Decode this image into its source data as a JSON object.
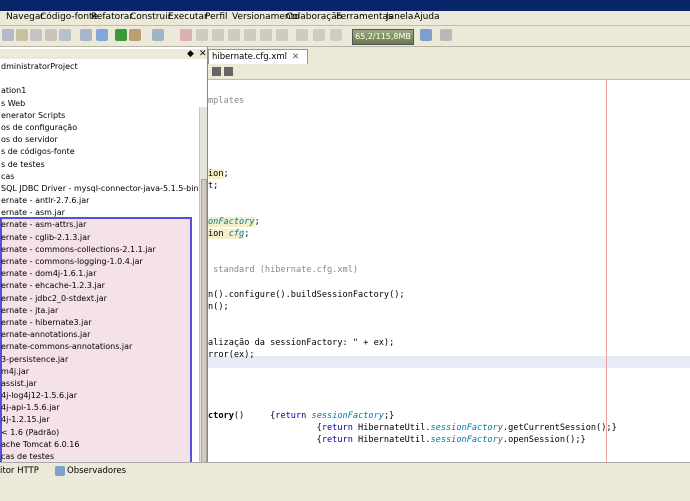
{
  "menu": [
    "Navegar",
    "Código-fonte",
    "Refatorar",
    "Construir",
    "Executar",
    "Perfil",
    "Versionamento",
    "Colaboração",
    "Ferramentas",
    "Janela",
    "Ajuda"
  ],
  "memory": "65,2/115,8MB",
  "project_panel": {
    "controls": {
      "restore": "◆",
      "close": "✕"
    },
    "items": [
      "dministratorProject",
      "",
      "ation1",
      "s Web",
      "enerator Scripts",
      "os de configuração",
      "os do servidor",
      "s de códigos-fonte",
      "s de testes",
      "cas",
      "SQL JDBC Driver - mysql-connector-java-5.1.5-bin.jar",
      "ernate - antlr-2.7.6.jar",
      "ernate - asm.jar",
      "ernate - asm-attrs.jar",
      "ernate - cglib-2.1.3.jar",
      "ernate - commons-collections-2.1.1.jar",
      "ernate - commons-logging-1.0.4.jar",
      "ernate - dom4j-1.6.1.jar",
      "ernate - ehcache-1.2.3.jar",
      "ernate - jdbc2_0-stdext.jar",
      "ernate - jta.jar",
      "ernate - hibernate3.jar",
      "ernate-annotations.jar",
      "ernate-commons-annotations.jar",
      "3-persistence.jar",
      "m4j.jar",
      "assist.jar",
      "4j-log4j12-1.5.6.jar",
      "4j-api-1.5.6.jar",
      "4j-1.2.15.jar",
      "< 1.6 (Padrão)",
      "ache Tomcat 6.0.16",
      "cas de testes"
    ]
  },
  "editor": {
    "tab_label": "hibernate.cfg.xml",
    "tab_close": "✕",
    "code": [
      {
        "segments": [
          {
            "t": "mplates",
            "c": "cm"
          }
        ]
      },
      {
        "segments": []
      },
      {
        "segments": []
      },
      {
        "segments": []
      },
      {
        "segments": []
      },
      {
        "segments": []
      },
      {
        "segments": [
          {
            "t": "ion",
            "c": "hl"
          },
          {
            "t": ";",
            "c": ""
          }
        ]
      },
      {
        "segments": [
          {
            "t": "t;",
            "c": ""
          }
        ]
      },
      {
        "segments": []
      },
      {
        "segments": []
      },
      {
        "segments": [
          {
            "t": "onFactory",
            "c": "it hl"
          },
          {
            "t": ";",
            "c": ""
          }
        ]
      },
      {
        "segments": [
          {
            "t": "ion ",
            "c": "hl"
          },
          {
            "t": "cfg",
            "c": "it hl"
          },
          {
            "t": ";",
            "c": ""
          }
        ]
      },
      {
        "segments": []
      },
      {
        "segments": []
      },
      {
        "segments": [
          {
            "t": " standard (hibernate.cfg.xml)",
            "c": "cm"
          }
        ]
      },
      {
        "segments": []
      },
      {
        "segments": [
          {
            "t": "n().configure().buildSessionFactory();",
            "c": ""
          }
        ]
      },
      {
        "segments": [
          {
            "t": "n();",
            "c": ""
          }
        ]
      },
      {
        "segments": []
      },
      {
        "segments": []
      },
      {
        "segments": [
          {
            "t": "alização da sessionFactory: \" + ex);",
            "c": ""
          }
        ]
      },
      {
        "segments": [
          {
            "t": "rror(ex);",
            "c": ""
          }
        ]
      },
      {
        "segments": []
      },
      {
        "segments": []
      },
      {
        "segments": []
      },
      {
        "segments": []
      },
      {
        "segments": [
          {
            "t": "ctory",
            "c": "fn"
          },
          {
            "t": "()     {",
            "c": ""
          },
          {
            "t": "return",
            "c": "kw"
          },
          {
            "t": " ",
            "c": ""
          },
          {
            "t": "sessionFactory",
            "c": "it"
          },
          {
            "t": ";}",
            "c": ""
          }
        ]
      },
      {
        "segments": [
          {
            "t": "                     {",
            "c": ""
          },
          {
            "t": "return",
            "c": "kw"
          },
          {
            "t": " HibernateUtil.",
            "c": ""
          },
          {
            "t": "sessionFactory",
            "c": "it"
          },
          {
            "t": ".getCurrentSession();}",
            "c": ""
          }
        ]
      },
      {
        "segments": [
          {
            "t": "                     {",
            "c": ""
          },
          {
            "t": "return",
            "c": "kw"
          },
          {
            "t": " HibernateUtil.",
            "c": ""
          },
          {
            "t": "sessionFactory",
            "c": "it"
          },
          {
            "t": ".openSession();}",
            "c": ""
          }
        ]
      }
    ]
  },
  "bottom_tabs": [
    "itor HTTP",
    "Observadores"
  ]
}
